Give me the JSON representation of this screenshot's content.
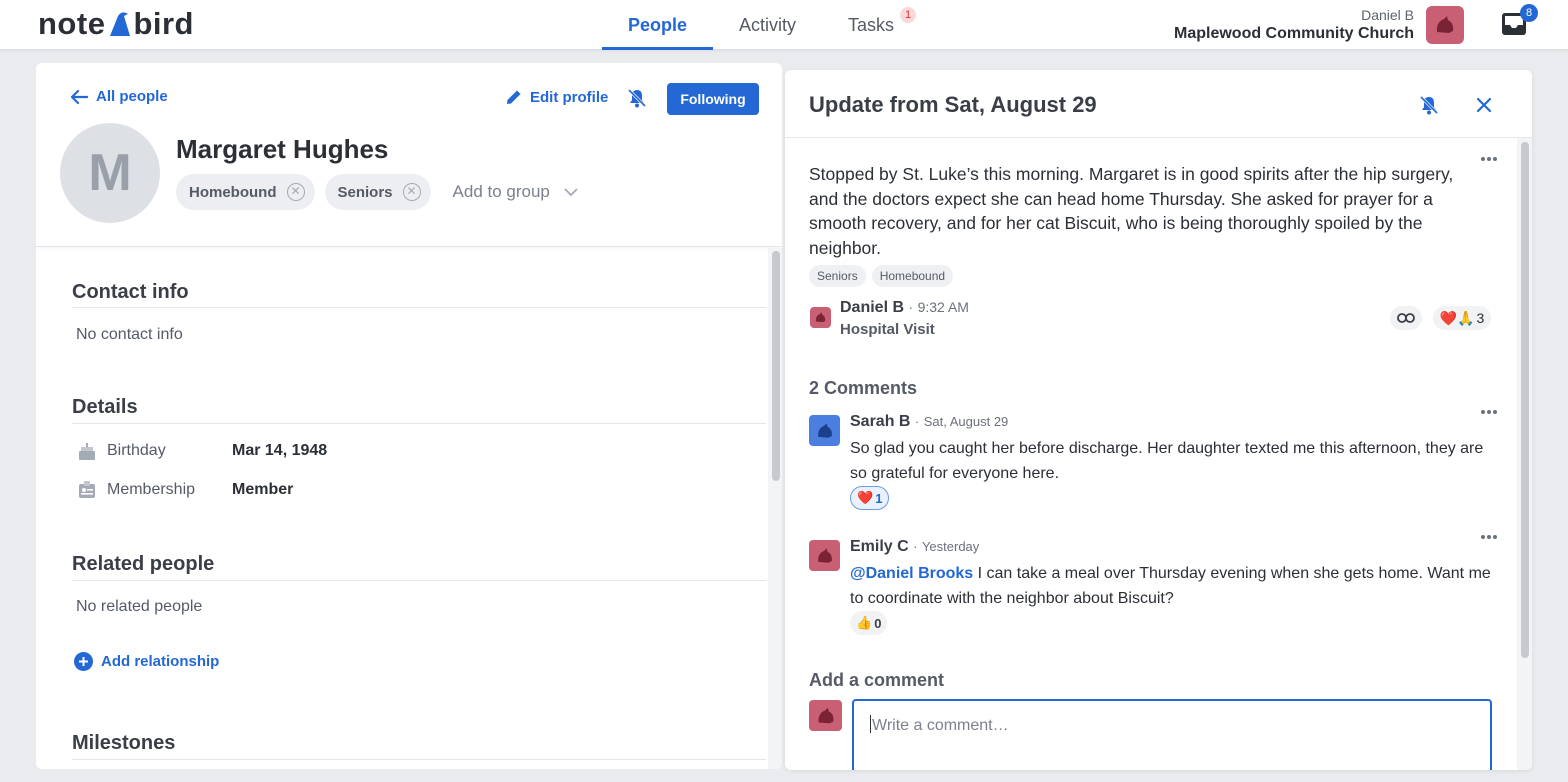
{
  "app": {
    "logo_left": "note",
    "logo_right": "bird"
  },
  "nav": {
    "tabs": [
      {
        "label": "People",
        "active": true
      },
      {
        "label": "Activity",
        "active": false
      },
      {
        "label": "Tasks",
        "active": false,
        "badge": "1"
      }
    ]
  },
  "account": {
    "user": "Daniel B",
    "org": "Maplewood Community Church",
    "inbox_count": "8"
  },
  "colors": {
    "accent": "#2468d6",
    "avatar_daniel": "#c95f72",
    "avatar_sarah": "#4a7fe0",
    "avatar_emily": "#c95f72"
  },
  "profile": {
    "back_label": "All people",
    "edit_label": "Edit profile",
    "follow_label": "Following",
    "initial": "M",
    "name": "Margaret Hughes",
    "groups": [
      "Homebound",
      "Seniors"
    ],
    "add_group_label": "Add to group",
    "sections": {
      "contact_title": "Contact info",
      "contact_empty": "No contact info",
      "details_title": "Details",
      "details": [
        {
          "icon": "cake-icon",
          "label": "Birthday",
          "value": "Mar 14, 1948"
        },
        {
          "icon": "badge-icon",
          "label": "Membership",
          "value": "Member"
        }
      ],
      "related_title": "Related people",
      "related_empty": "No related people",
      "add_relationship_label": "Add relationship",
      "milestones_title": "Milestones"
    }
  },
  "update": {
    "title": "Update from Sat, August 29",
    "body": "Stopped by St. Luke’s this morning. Margaret is in good spirits after the hip surgery, and the doctors expect she can head home Thursday. She asked for prayer for a smooth recovery, and for her cat Biscuit, who is being thoroughly spoiled by the neighbor.",
    "tags": [
      "Seniors",
      "Homebound"
    ],
    "author": "Daniel B",
    "separator": "·",
    "time": "9:32 AM",
    "type": "Hospital Visit",
    "reactions": {
      "emoji": "❤️🙏",
      "count": "3"
    }
  },
  "comments": {
    "title": "2 Comments",
    "items": [
      {
        "author": "Sarah B",
        "time": "Sat, August 29",
        "mention": "",
        "text": "So glad you caught her before discharge. Her daughter texted me this afternoon, they are so grateful for everyone here.",
        "reaction_emoji": "❤️",
        "reaction_count": "1"
      },
      {
        "author": "Emily C",
        "time": "Yesterday",
        "mention": "@Daniel Brooks",
        "text": " I can take a meal over Thursday evening when she gets home. Want me to coordinate with the neighbor about Biscuit?",
        "reaction_emoji": "👍",
        "reaction_count": "0"
      }
    ],
    "add_title": "Add a comment",
    "placeholder": "Write a comment…"
  }
}
